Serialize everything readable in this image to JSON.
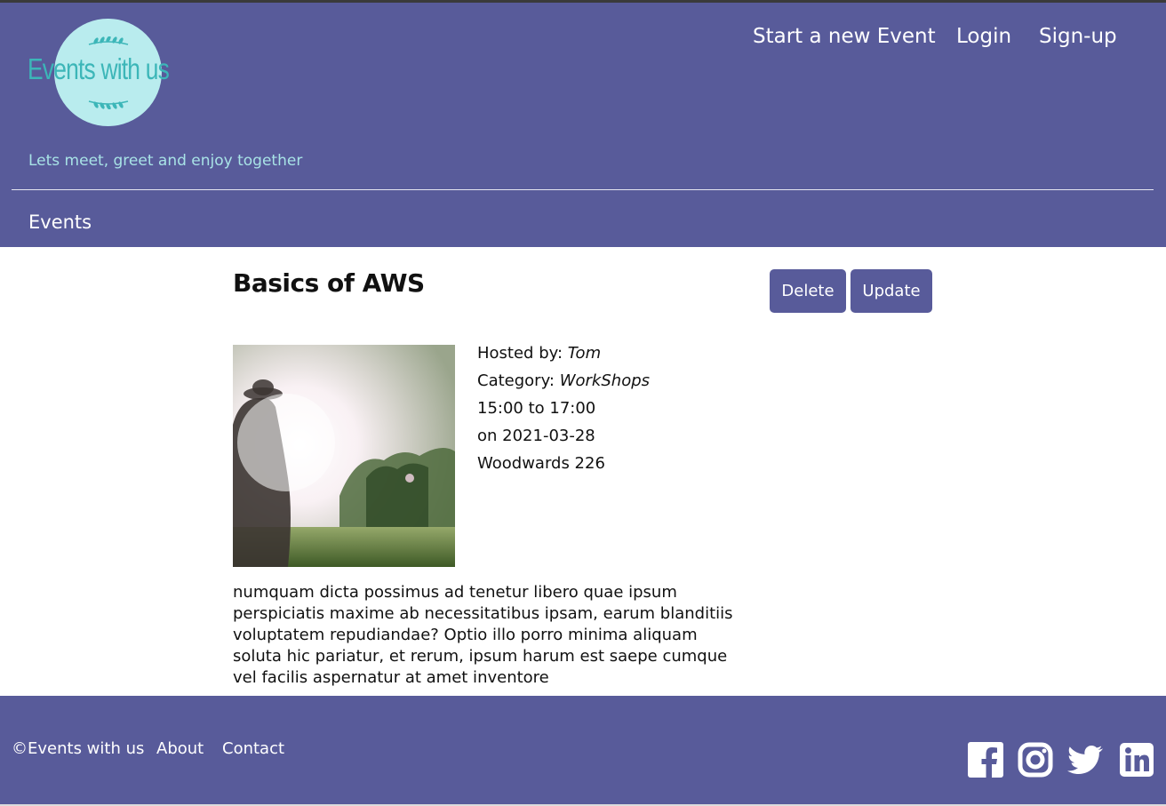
{
  "brand": {
    "logo_text": "Events with us",
    "tagline": "Lets meet, greet and enjoy together"
  },
  "nav": {
    "start_event": "Start a new Event",
    "login": "Login",
    "signup": "Sign-up",
    "events": "Events"
  },
  "event": {
    "title": "Basics of AWS",
    "delete_label": "Delete",
    "update_label": "Update",
    "hosted_label": "Hosted by:",
    "host": "Tom",
    "category_label": "Category:",
    "category": "WorkShops",
    "time": "15:00 to 17:00",
    "date": "on 2021-03-28",
    "location": "Woodwards 226",
    "description": "numquam dicta possimus ad tenetur libero quae ipsum perspiciatis maxime ab necessitatibus ipsam, earum blanditiis voluptatem repudiandae? Optio illo porro minima aliquam soluta hic pariatur, et rerum, ipsum harum est saepe cumque vel facilis aspernatur at amet inventore"
  },
  "footer": {
    "copyright": "©Events with us",
    "about": "About",
    "contact": "Contact",
    "social_icons": [
      "facebook-icon",
      "instagram-icon",
      "twitter-icon",
      "linkedin-icon"
    ]
  },
  "colors": {
    "primary": "#585b9a",
    "logo_circle": "#b9ecee",
    "logo_text": "#3cb6b8",
    "tagline": "#a8e3e6"
  }
}
